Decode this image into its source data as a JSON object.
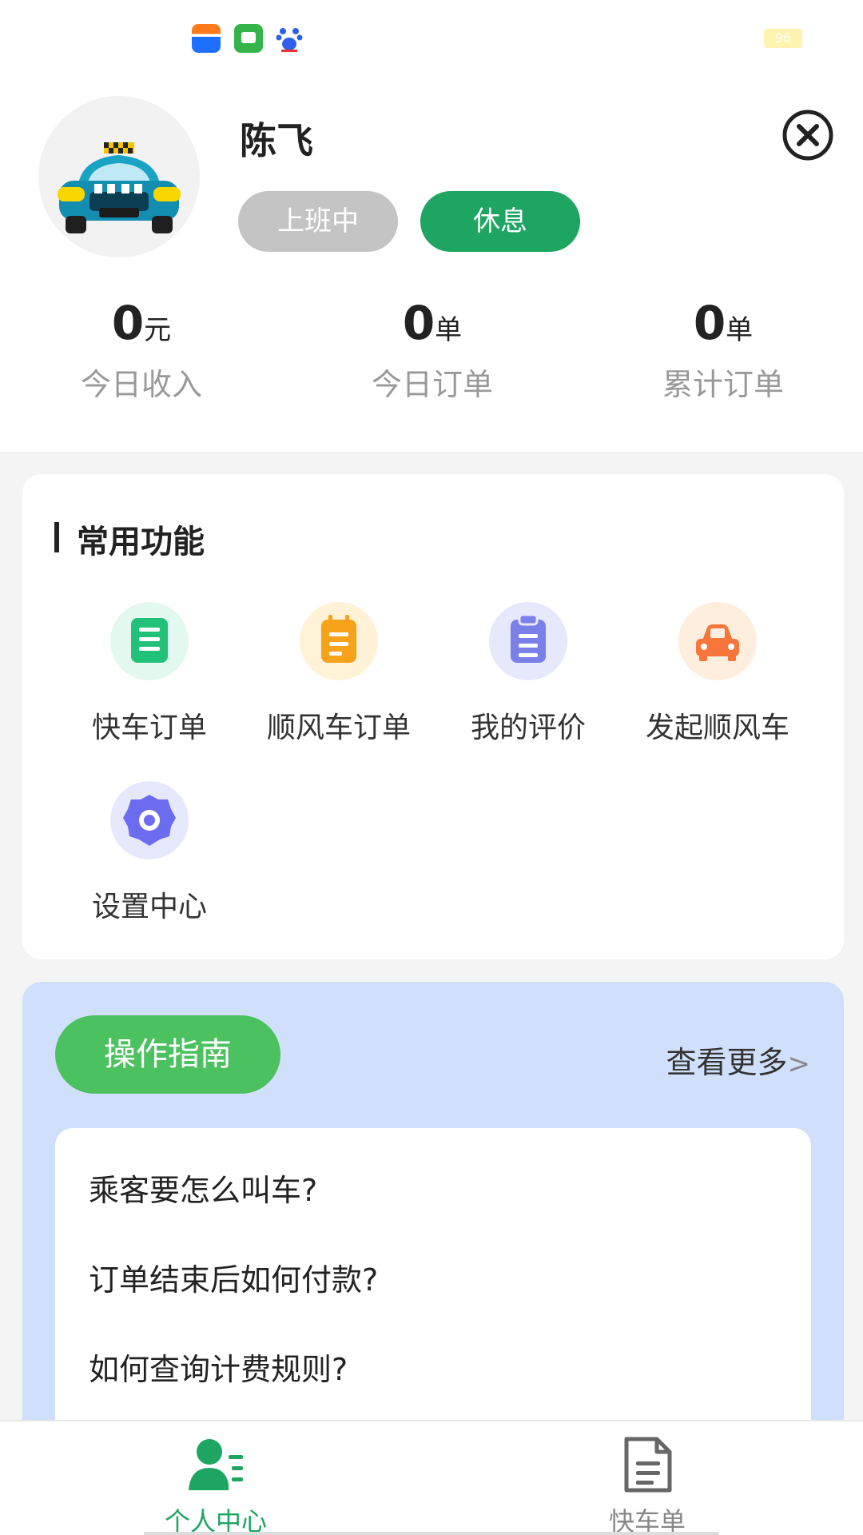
{
  "status_bar": {
    "icons": [
      "wallet-app-icon",
      "messages-app-icon",
      "baidu-app-icon"
    ],
    "battery": "96"
  },
  "profile": {
    "name": "陈飞",
    "on_duty_label": "上班中",
    "rest_label": "休息",
    "accent": "#1fa562"
  },
  "stats": [
    {
      "value": "0",
      "unit": "元",
      "label": "今日收入"
    },
    {
      "value": "0",
      "unit": "单",
      "label": "今日订单"
    },
    {
      "value": "0",
      "unit": "单",
      "label": "累计订单"
    }
  ],
  "functions": {
    "title": "常用功能",
    "items": [
      {
        "label": "快车订单",
        "icon": "order-list-icon",
        "color": "#2ec27e"
      },
      {
        "label": "顺风车订单",
        "icon": "notepad-icon",
        "color": "#f7a21b"
      },
      {
        "label": "我的评价",
        "icon": "clipboard-icon",
        "color": "#7b7fe8"
      },
      {
        "label": "发起顺风车",
        "icon": "car-icon",
        "color": "#f6763c"
      },
      {
        "label": "设置中心",
        "icon": "gear-icon",
        "color": "#6c6cf0"
      }
    ]
  },
  "guide": {
    "button_label": "操作指南",
    "more_label": "查看更多",
    "more_arrow": ">",
    "items": [
      "乘客要怎么叫车?",
      "订单结束后如何付款?",
      "如何查询计费规则?"
    ]
  },
  "bottom_nav": {
    "items": [
      {
        "label": "个人中心",
        "icon": "person-list-icon",
        "active": true
      },
      {
        "label": "快车单",
        "icon": "document-icon",
        "active": false
      }
    ],
    "active_color": "#1fa562",
    "inactive_color": "#888888"
  }
}
